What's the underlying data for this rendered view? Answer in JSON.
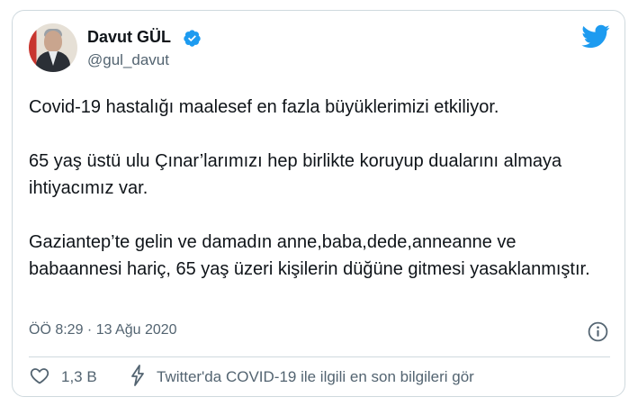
{
  "author": {
    "display_name": "Davut GÜL",
    "handle": "@gul_davut",
    "verified": true
  },
  "tweet": {
    "text": "Covid-19 hastalığı maalesef en fazla büyüklerimizi etkiliyor.\n\n65 yaş üstü ulu Çınar’larımızı hep birlikte koruyup dualarını almaya ihtiyacımız var.\n\nGaziantep’te gelin ve damadın anne,baba,dede,anneanne ve babaannesi hariç, 65 yaş üzeri kişilerin düğüne gitmesi yasaklanmıştır.",
    "timestamp": "ÖÖ 8:29 · 13 Ağu 2020"
  },
  "actions": {
    "like_count": "1,3 B",
    "covid_info_label": "Twitter'da COVID-19 ile ilgili en son bilgileri gör"
  },
  "icons": {
    "brand": "twitter-bird-icon",
    "verified": "verified-badge-icon",
    "info": "info-icon",
    "like": "heart-icon",
    "covid": "lightning-bolt-icon"
  },
  "colors": {
    "brand_blue": "#1d9bf0",
    "text_primary": "#0f1419",
    "text_secondary": "#536471",
    "border": "#cfd9de"
  }
}
